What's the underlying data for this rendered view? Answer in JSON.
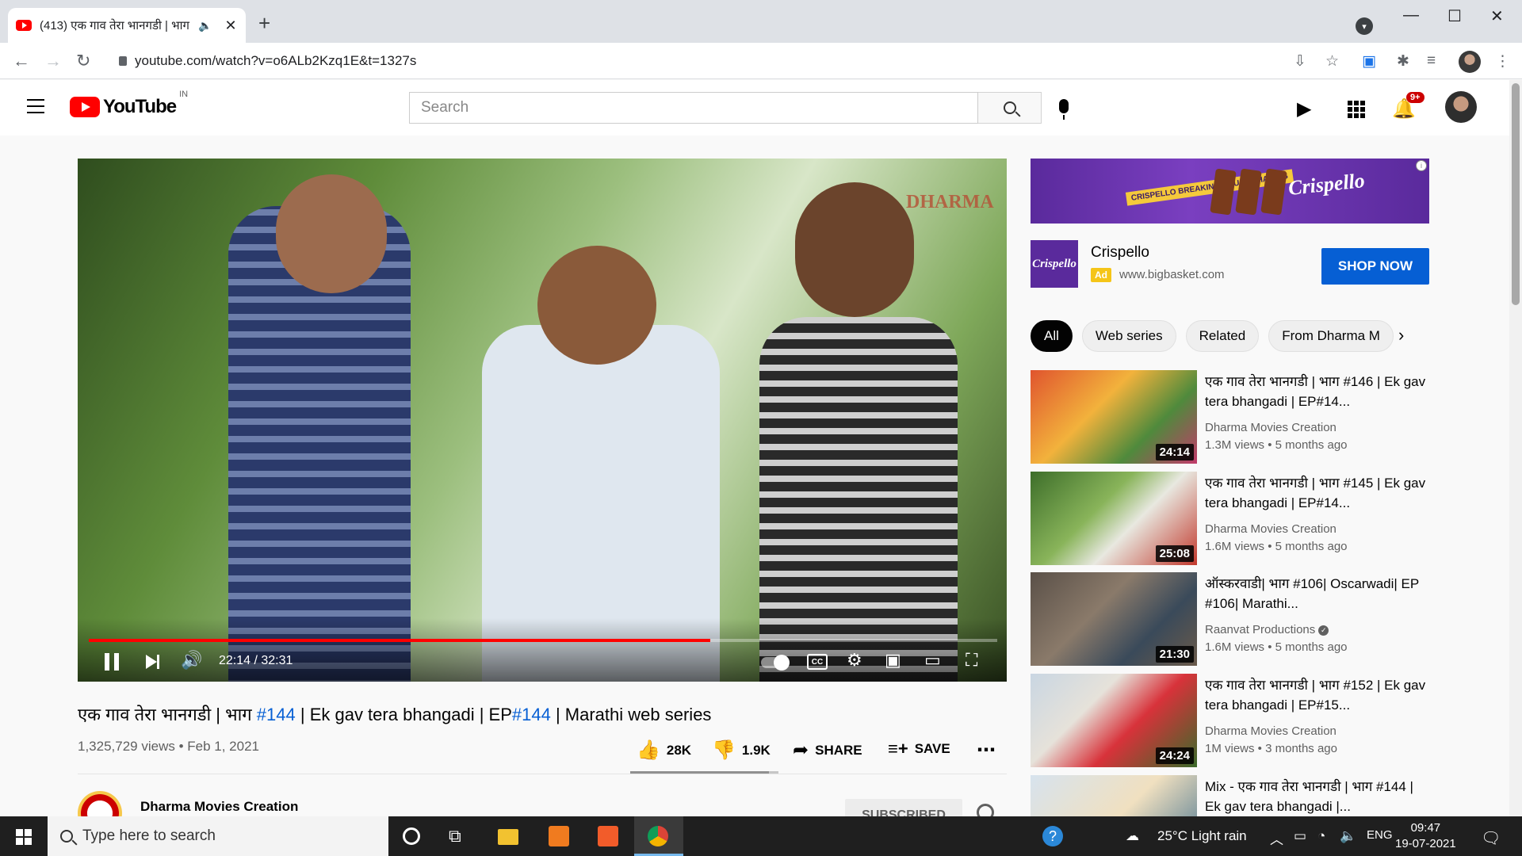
{
  "browser": {
    "tab_title": "(413) एक गाव तेरा भानगडी | भाग",
    "url": "youtube.com/watch?v=o6ALb2Kzq1E&t=1327s"
  },
  "header": {
    "logo_text": "YouTube",
    "region": "IN",
    "search_placeholder": "Search",
    "notification_count": "9+"
  },
  "player": {
    "time": "22:14 / 32:31",
    "progress_fraction": 0.684,
    "watermark": "DHARMA"
  },
  "video": {
    "title_prefix": "एक गाव तेरा भानगडी | भाग ",
    "title_tag1": "#144",
    "title_middle": " | Ek gav tera bhangadi | EP",
    "title_tag2": "#144",
    "title_suffix": " | Marathi web series",
    "meta": "1,325,729 views • Feb 1, 2021",
    "likes": "28K",
    "dislikes": "1.9K",
    "share_label": "SHARE",
    "save_label": "SAVE",
    "like_fraction": 0.937
  },
  "channel": {
    "name": "Dharma Movies Creation",
    "subscribe_label": "SUBSCRIBED"
  },
  "ad": {
    "title": "Crispello",
    "badge": "Ad",
    "domain": "www.bigbasket.com",
    "cta": "SHOP NOW",
    "banner_brand": "Crispello",
    "banner_tagline": "CRISPELLO BREAKING EQUAL SHARING",
    "logo_text": "Crispello"
  },
  "chips": [
    {
      "label": "All",
      "active": true
    },
    {
      "label": "Web series",
      "active": false
    },
    {
      "label": "Related",
      "active": false
    },
    {
      "label": "From Dharma M",
      "active": false
    }
  ],
  "recommendations": [
    {
      "title": "एक गाव तेरा भानगडी | भाग #146 | Ek gav tera bhangadi | EP#14...",
      "channel": "Dharma Movies Creation",
      "meta": "1.3M views • 5 months ago",
      "duration": "24:14",
      "verified": false
    },
    {
      "title": "एक गाव तेरा भानगडी | भाग #145 | Ek gav tera bhangadi | EP#14...",
      "channel": "Dharma Movies Creation",
      "meta": "1.6M views • 5 months ago",
      "duration": "25:08",
      "verified": false
    },
    {
      "title": "ऑस्करवाडी| भाग #106| Oscarwadi| EP #106| Marathi...",
      "channel": "Raanvat Productions",
      "meta": "1.6M views • 5 months ago",
      "duration": "21:30",
      "verified": true
    },
    {
      "title": "एक गाव तेरा भानगडी | भाग #152 | Ek gav tera bhangadi | EP#15...",
      "channel": "Dharma Movies Creation",
      "meta": "1M views • 3 months ago",
      "duration": "24:24",
      "verified": false
    },
    {
      "title": "Mix - एक गाव तेरा भानगडी | भाग #144 | Ek gav tera bhangadi |...",
      "channel": "",
      "meta": "",
      "duration": "",
      "verified": false
    }
  ],
  "taskbar": {
    "search_placeholder": "Type here to search",
    "weather": "25°C  Light rain",
    "language": "ENG",
    "time": "09:47",
    "date": "19-07-2021"
  },
  "colors": {
    "yt_red": "#ff0000",
    "link_blue": "#065fd4",
    "cta_blue": "#065fd4",
    "ad_purple": "#5a2a9c"
  }
}
